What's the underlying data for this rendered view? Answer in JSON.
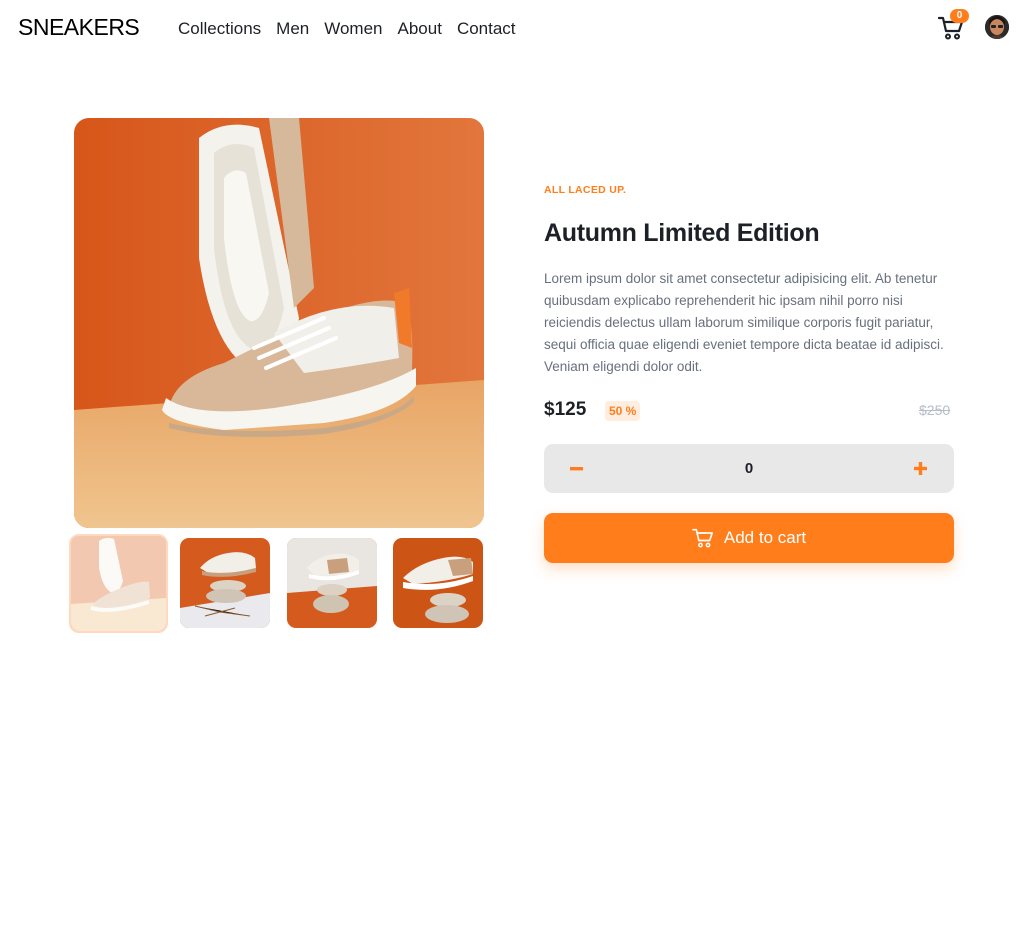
{
  "header": {
    "logo": "SNEAKERS",
    "nav": [
      "Collections",
      "Men",
      "Women",
      "About",
      "Contact"
    ],
    "cart_count": "0"
  },
  "product": {
    "eyebrow": "ALL LACED UP.",
    "title": "Autumn Limited Edition",
    "description": "Lorem ipsum dolor sit amet consectetur adipisicing elit. Ab tenetur quibusdam explicabo reprehenderit hic ipsam nihil porro nisi reiciendis delectus ullam laborum similique corporis fugit pariatur, sequi officia quae eligendi eveniet tempore dicta beatae id adipisci. Veniam eligendi dolor odit.",
    "price": "$125",
    "discount": "50 %",
    "old_price": "$250"
  },
  "quantity": {
    "minus": "−",
    "value": "0",
    "plus": "+"
  },
  "add_to_cart": "Add to cart",
  "icons": {
    "cart": "cart-icon",
    "avatar": "avatar",
    "add_cart": "cart-icon"
  },
  "colors": {
    "accent": "#ff7e1b",
    "accent_pale": "#ffede0",
    "text_dark": "#1d2026",
    "text_gray": "#68707d",
    "qty_bg": "#e8e8e8"
  }
}
